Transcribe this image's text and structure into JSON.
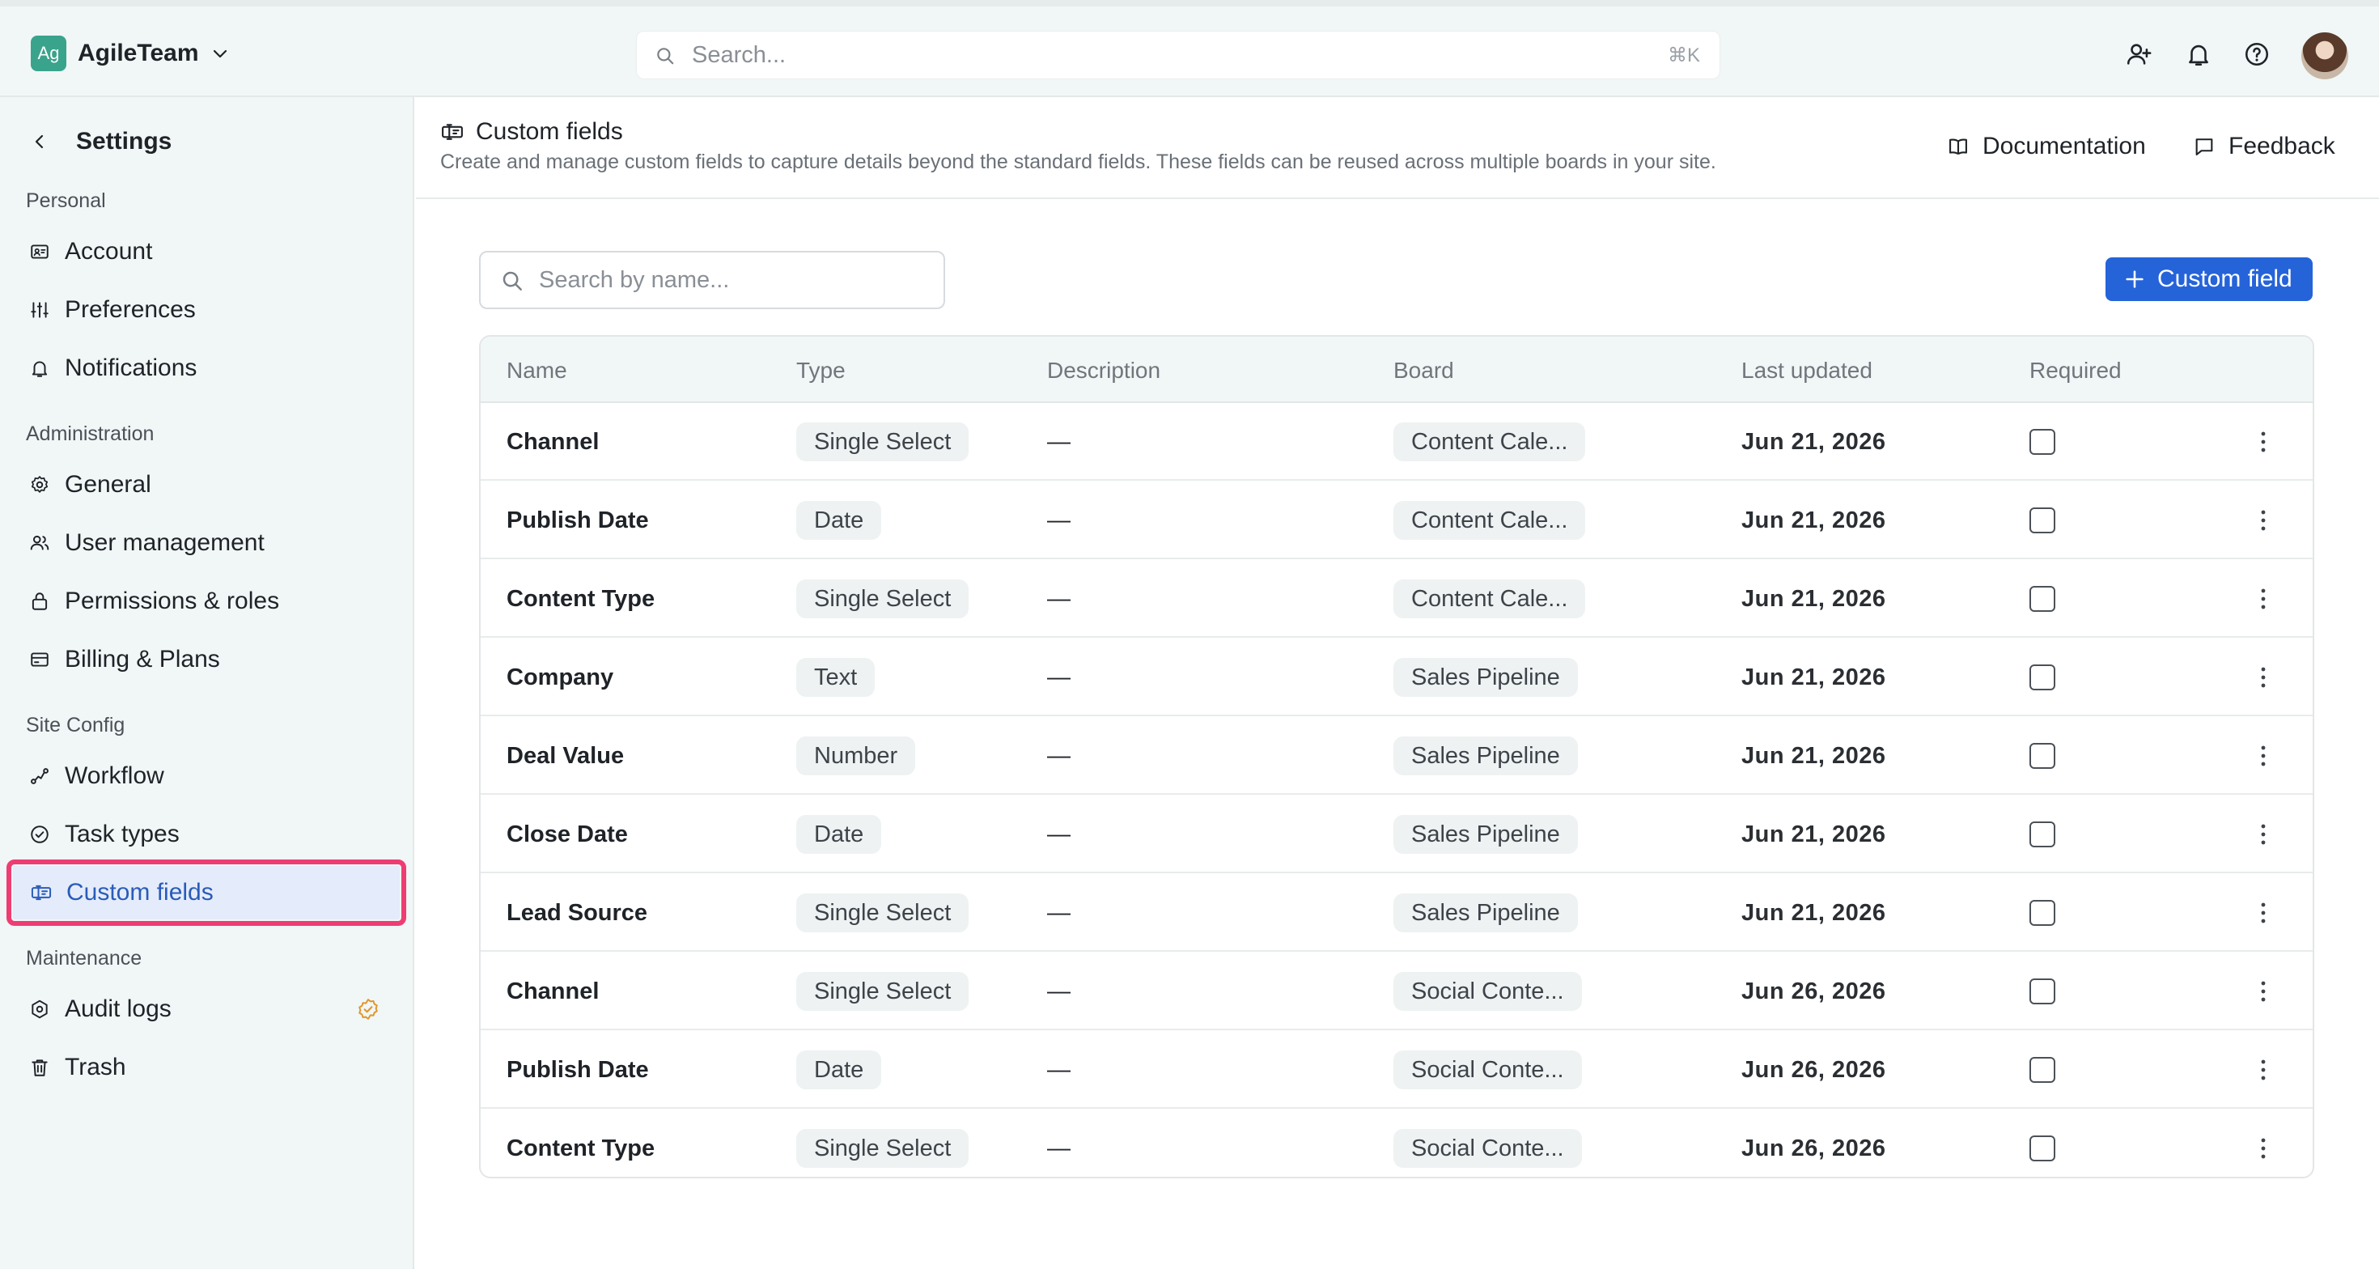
{
  "topbar": {
    "workspace_initials": "Ag",
    "workspace_name": "AgileTeam",
    "search_placeholder": "Search...",
    "search_shortcut": "⌘K"
  },
  "sidebar": {
    "title": "Settings",
    "sections": {
      "personal": "Personal",
      "administration": "Administration",
      "site_config": "Site Config",
      "maintenance": "Maintenance"
    },
    "items": [
      {
        "label": "Account",
        "icon": "id-card-icon"
      },
      {
        "label": "Preferences",
        "icon": "sliders-icon"
      },
      {
        "label": "Notifications",
        "icon": "bell-icon"
      },
      {
        "label": "General",
        "icon": "gear-icon"
      },
      {
        "label": "User management",
        "icon": "users-icon"
      },
      {
        "label": "Permissions & roles",
        "icon": "lock-icon"
      },
      {
        "label": "Billing & Plans",
        "icon": "credit-card-icon"
      },
      {
        "label": "Workflow",
        "icon": "workflow-icon"
      },
      {
        "label": "Task types",
        "icon": "check-circle-icon"
      },
      {
        "label": "Custom fields",
        "icon": "custom-field-icon",
        "active": true
      },
      {
        "label": "Audit logs",
        "icon": "audit-icon",
        "badge": "verified-badge-icon"
      },
      {
        "label": "Trash",
        "icon": "trash-icon"
      }
    ]
  },
  "page": {
    "title": "Custom fields",
    "description": "Create and manage custom fields to capture details beyond the standard fields. These fields can be reused across multiple boards in your site.",
    "documentation": "Documentation",
    "feedback": "Feedback"
  },
  "toolbar": {
    "search_placeholder": "Search by name...",
    "add_label": "Custom field"
  },
  "table": {
    "columns": [
      "Name",
      "Type",
      "Description",
      "Board",
      "Last updated",
      "Required"
    ],
    "rows": [
      {
        "name": "Channel",
        "type": "Single Select",
        "description": "—",
        "board": "Content Cale...",
        "updated": "Jun 21, 2026",
        "required": false
      },
      {
        "name": "Publish Date",
        "type": "Date",
        "description": "—",
        "board": "Content Cale...",
        "updated": "Jun 21, 2026",
        "required": false
      },
      {
        "name": "Content Type",
        "type": "Single Select",
        "description": "—",
        "board": "Content Cale...",
        "updated": "Jun 21, 2026",
        "required": false
      },
      {
        "name": "Company",
        "type": "Text",
        "description": "—",
        "board": "Sales Pipeline",
        "updated": "Jun 21, 2026",
        "required": false
      },
      {
        "name": "Deal Value",
        "type": "Number",
        "description": "—",
        "board": "Sales Pipeline",
        "updated": "Jun 21, 2026",
        "required": false
      },
      {
        "name": "Close Date",
        "type": "Date",
        "description": "—",
        "board": "Sales Pipeline",
        "updated": "Jun 21, 2026",
        "required": false
      },
      {
        "name": "Lead Source",
        "type": "Single Select",
        "description": "—",
        "board": "Sales Pipeline",
        "updated": "Jun 21, 2026",
        "required": false
      },
      {
        "name": "Channel",
        "type": "Single Select",
        "description": "—",
        "board": "Social Conte...",
        "updated": "Jun 26, 2026",
        "required": false
      },
      {
        "name": "Publish Date",
        "type": "Date",
        "description": "—",
        "board": "Social Conte...",
        "updated": "Jun 26, 2026",
        "required": false
      },
      {
        "name": "Content Type",
        "type": "Single Select",
        "description": "—",
        "board": "Social Conte...",
        "updated": "Jun 26, 2026",
        "required": false
      }
    ]
  },
  "colors": {
    "accent": "#2563d9",
    "highlight": "#ee3d73",
    "active_bg": "#e4ecfb",
    "workspace": "#3aa38c",
    "audit_badge": "#e0962a"
  }
}
